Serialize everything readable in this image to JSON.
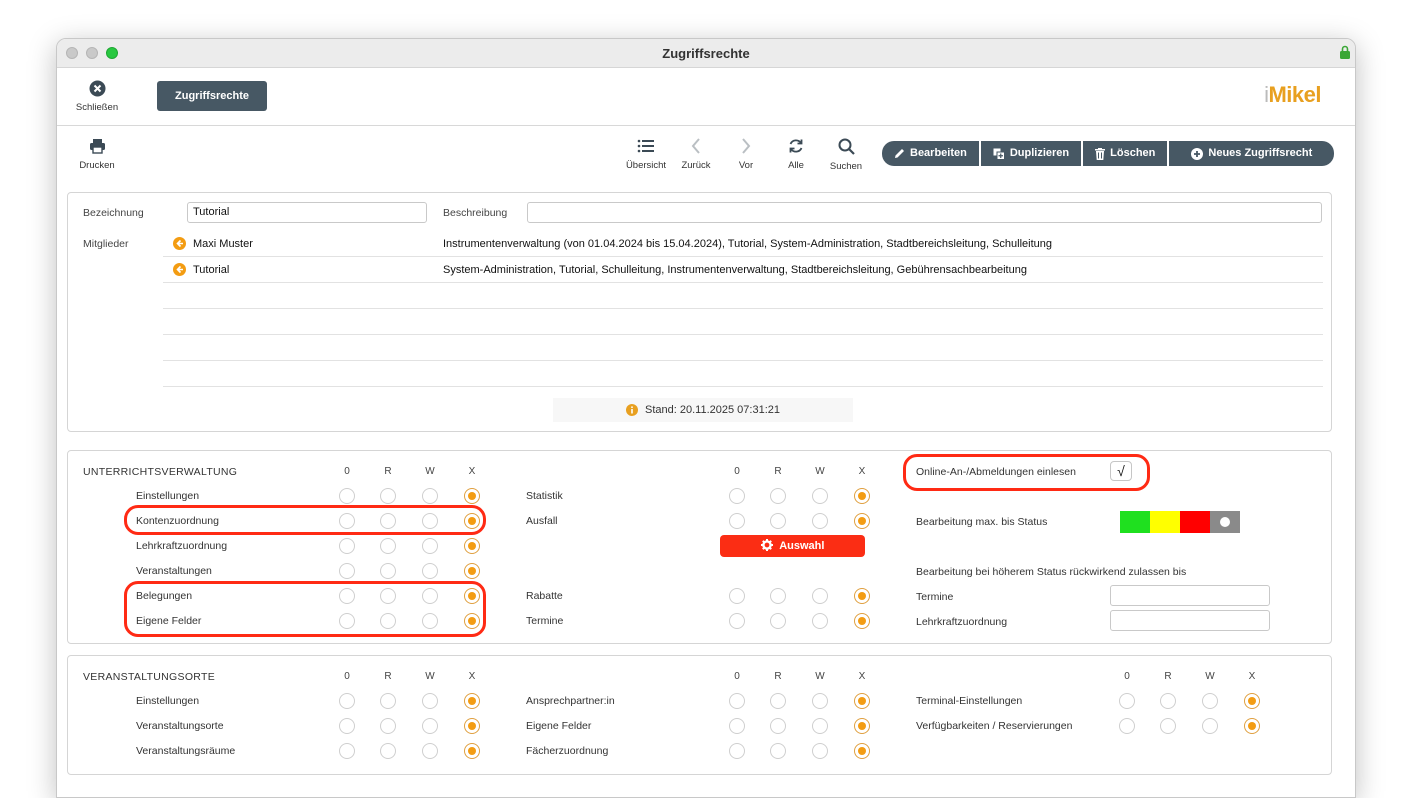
{
  "window": {
    "title": "Zugriffsrechte"
  },
  "topbar": {
    "close_label": "Schließen",
    "tab_label": "Zugriffsrechte",
    "logo_i": "i",
    "logo_text": "Mikel"
  },
  "toolbar": {
    "print_label": "Drucken",
    "overview_label": "Übersicht",
    "back_label": "Zurück",
    "forward_label": "Vor",
    "all_label": "Alle",
    "search_label": "Suchen",
    "edit_label": "Bearbeiten",
    "duplicate_label": "Duplizieren",
    "delete_label": "Löschen",
    "new_label": "Neues Zugriffsrecht"
  },
  "form": {
    "bezeichnung_label": "Bezeichnung",
    "bezeichnung_value": "Tutorial",
    "beschreibung_label": "Beschreibung",
    "beschreibung_value": "",
    "mitglieder_label": "Mitglieder",
    "members": [
      {
        "name": "Maxi Muster",
        "roles": "Instrumentenverwaltung (von 01.04.2024 bis 15.04.2024), Tutorial, System-Administration, Stadtbereichsleitung, Schulleitung"
      },
      {
        "name": "Tutorial",
        "roles": "System-Administration, Tutorial, Schulleitung, Instrumentenverwaltung, Stadtbereichsleitung, Gebührensachbearbeitung"
      }
    ],
    "stand": "Stand: 20.11.2025 07:31:21"
  },
  "headers": {
    "h0": "0",
    "hR": "R",
    "hW": "W",
    "hX": "X"
  },
  "unterricht": {
    "title": "UNTERRICHTSVERWALTUNG",
    "left": [
      {
        "label": "Einstellungen",
        "value": "X"
      },
      {
        "label": "Kontenzuordnung",
        "value": "X"
      },
      {
        "label": "Lehrkraftzuordnung",
        "value": "X"
      },
      {
        "label": "Veranstaltungen",
        "value": "X"
      },
      {
        "label": "Belegungen",
        "value": "X"
      },
      {
        "label": "Eigene Felder",
        "value": "X"
      }
    ],
    "middle": [
      {
        "label": "Statistik",
        "value": "X"
      },
      {
        "label": "Ausfall",
        "value": "X"
      },
      {
        "label": "Rabatte",
        "value": "X"
      },
      {
        "label": "Termine",
        "value": "X"
      }
    ],
    "auswahl_label": "Auswahl",
    "online_label": "Online-An-/Abmeldungen einlesen",
    "online_checked": "√",
    "status_label": "Bearbeitung max. bis Status",
    "status_colors": [
      "#1fe01f",
      "#ffff00",
      "#ff0000",
      "#8a8a8a"
    ],
    "rueckwirkend_label": "Bearbeitung bei höherem Status rückwirkend zulassen bis",
    "termine_label": "Termine",
    "termine_value": "",
    "lehrkraft_label": "Lehrkraftzuordnung",
    "lehrkraft_value": ""
  },
  "orte": {
    "title": "VERANSTALTUNGSORTE",
    "left": [
      {
        "label": "Einstellungen",
        "value": "X"
      },
      {
        "label": "Veranstaltungsorte",
        "value": "X"
      },
      {
        "label": "Veranstaltungsräume",
        "value": "X"
      }
    ],
    "middle": [
      {
        "label": "Ansprechpartner:in",
        "value": "X"
      },
      {
        "label": "Eigene Felder",
        "value": "X"
      },
      {
        "label": "Fächerzuordnung",
        "value": "X"
      }
    ],
    "right": [
      {
        "label": "Terminal-Einstellungen",
        "value": "X"
      },
      {
        "label": "Verfügbarkeiten / Reservierungen",
        "value": "X"
      }
    ]
  }
}
